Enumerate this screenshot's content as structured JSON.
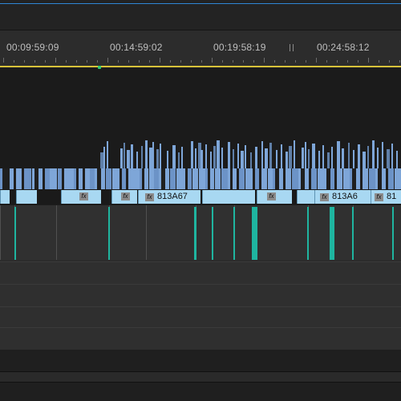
{
  "ruler": {
    "timecodes": [
      "00:09:59:09",
      "00:14:59:02",
      "00:19:58:19",
      "00:24:58:12"
    ]
  },
  "track_labels": [
    "813A67",
    "813A6",
    "81"
  ],
  "fx_badge": "fx",
  "colors": {
    "accent_blue": "#2f86d6",
    "work_area_bar": "#d7c23a",
    "playhead_marker": "#2ecc71",
    "video_clip": "#7ea6d8",
    "clip_label_bar": "#a8d8f2",
    "audio_waveform_teal": "#1fb5a0"
  }
}
